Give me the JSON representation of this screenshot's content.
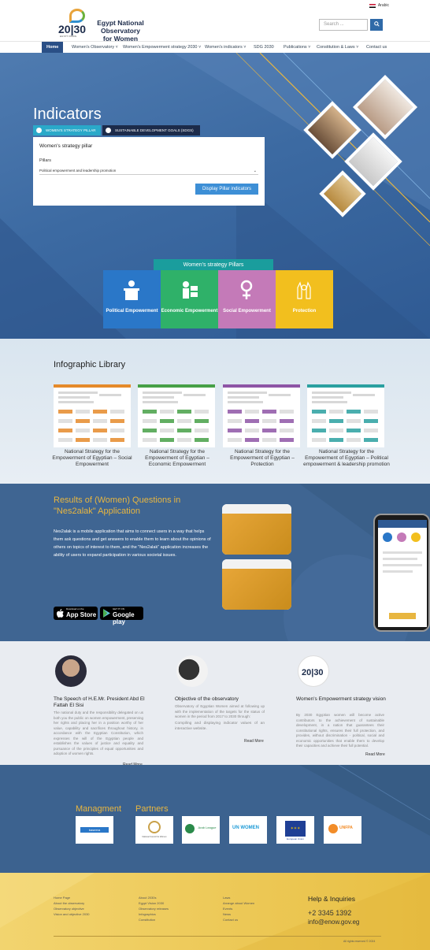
{
  "header": {
    "language": "Arabic",
    "logo_number": "20|30",
    "logo_sub": "EGYPT VISION",
    "brand_line1": "Egypt National Observatory",
    "brand_line2": "for Women",
    "search_placeholder": "Search ...",
    "search_icon": "search-icon"
  },
  "nav": {
    "items": [
      "Home",
      "Women's Observatory ˅",
      "Women's Empowerment strategy 2030 ˅",
      "Women's indicators ˅",
      "SDG 2030",
      "Publications ˅",
      "Constitution & Laws ˅",
      "Contact us"
    ]
  },
  "hero": {
    "title": "Indicators",
    "tab_strategy": "WOMEN'S STRATEGY PILLAR",
    "tab_sdg": "SUSTAINABLE DEVELOPMENT GOALS (SDGS)",
    "panel_heading": "Women's strategy pillar",
    "pillars_label": "Pillars",
    "pillars_value": "Political empowerment and leadership promotion",
    "display_button": "Display Pillar indicators"
  },
  "pillars": {
    "title": "Women's strategy Pillars",
    "items": [
      {
        "label": "Political Empowerment",
        "color": "#2a77c8",
        "icon": "podium-icon"
      },
      {
        "label": "Economic Empowerment",
        "color": "#2fb169",
        "icon": "money-icon"
      },
      {
        "label": "Social Empowerment",
        "color": "#c47ab8",
        "icon": "female-symbol-icon"
      },
      {
        "label": "Protection",
        "color": "#f2bf1e",
        "icon": "hands-icon"
      }
    ]
  },
  "infographic": {
    "title": "Infographic Library",
    "cards": [
      {
        "caption": "National Strategy for the Empowerment of Egyptian – Social Empowerment",
        "color": "#e58a2a"
      },
      {
        "caption": "National Strategy for the Empowerment of Egyptian – Economic Empowerment",
        "color": "#47a047"
      },
      {
        "caption": "National Strategy for the Empowerment of Egyptian – Protection",
        "color": "#8e55a6"
      },
      {
        "caption": "National Strategy for the Empowerment of Egyptian – Political empowerment & leadership promotion",
        "color": "#2aa0a0"
      }
    ]
  },
  "app": {
    "title": "Results of (Women) Questions in \"Nes2alak\" Application",
    "description": "Nes2alak is a mobile application that aims to connect users in a way that helps them ask questions and get answers to enable them to learn about the opinions of others on topics of interest to them, and the \"Nes2alak\" application increases the ability of users to expand participation in various societal issues.",
    "appstore_small": "Download on the",
    "appstore_big": "App Store",
    "googleplay_small": "GET IT ON",
    "googleplay_big": "Google play"
  },
  "about": {
    "items": [
      {
        "title": "The Speech of H.E.Mr. President Abd El Fattah El Sisi",
        "text": "The national duty and the responsibility delegated on us both you the public on women empowerment, preserving her rights and placing her in a position worthy of her value, capability and sacrifices throughout history, in accordance with the Egyptian Constitution, which expresses the will of the Egyptian people and establishes the values of justice and equality and pursuance of the principles of equal opportunities and adoption of women rights.",
        "read_more": "Read More"
      },
      {
        "title": "Objective of the observatory",
        "text": "Observatory of Egyptian Women aimed at following up with the implementation of the targets for the status of women in the period from 2017 to 2030 through:",
        "text2": "Compiling and displaying indicator values of an interactive website.",
        "read_more": "Read More"
      },
      {
        "title": "Women's Empowerment strategy vision",
        "text": "By 2030 Egyptian women will become active contributors to the achievement of sustainable development, in a nation that guarantees their constitutional rights, ensures their full protection, and provides, without discrimination - political, social and economic opportunities that enable them to develop their capacities and achieve their full potential.",
        "read_more": "Read More"
      }
    ]
  },
  "partners": {
    "management_title": "Managment",
    "partners_title": "Partners",
    "logos": [
      "baseera",
      "National Council for Women",
      "Arab League",
      "UN WOMEN",
      "European Union",
      "UNFPA"
    ]
  },
  "footer": {
    "col1": [
      "Home Page",
      "About the observatory",
      "Observatory objective",
      "Vision and objective 2030"
    ],
    "col2": [
      "About 2030s",
      "Egypt Vision 2030",
      "Observatory releases",
      "Infographics",
      "Constitution"
    ],
    "col3": [
      "Laws",
      "Arrange about Women",
      "Events",
      "News",
      "Contact us"
    ],
    "help_title": "Help & Inquiries",
    "phone": "+2 3345 1392",
    "email": "info@enow.gov.eg",
    "copyright": "All rights reserved © 2024"
  }
}
